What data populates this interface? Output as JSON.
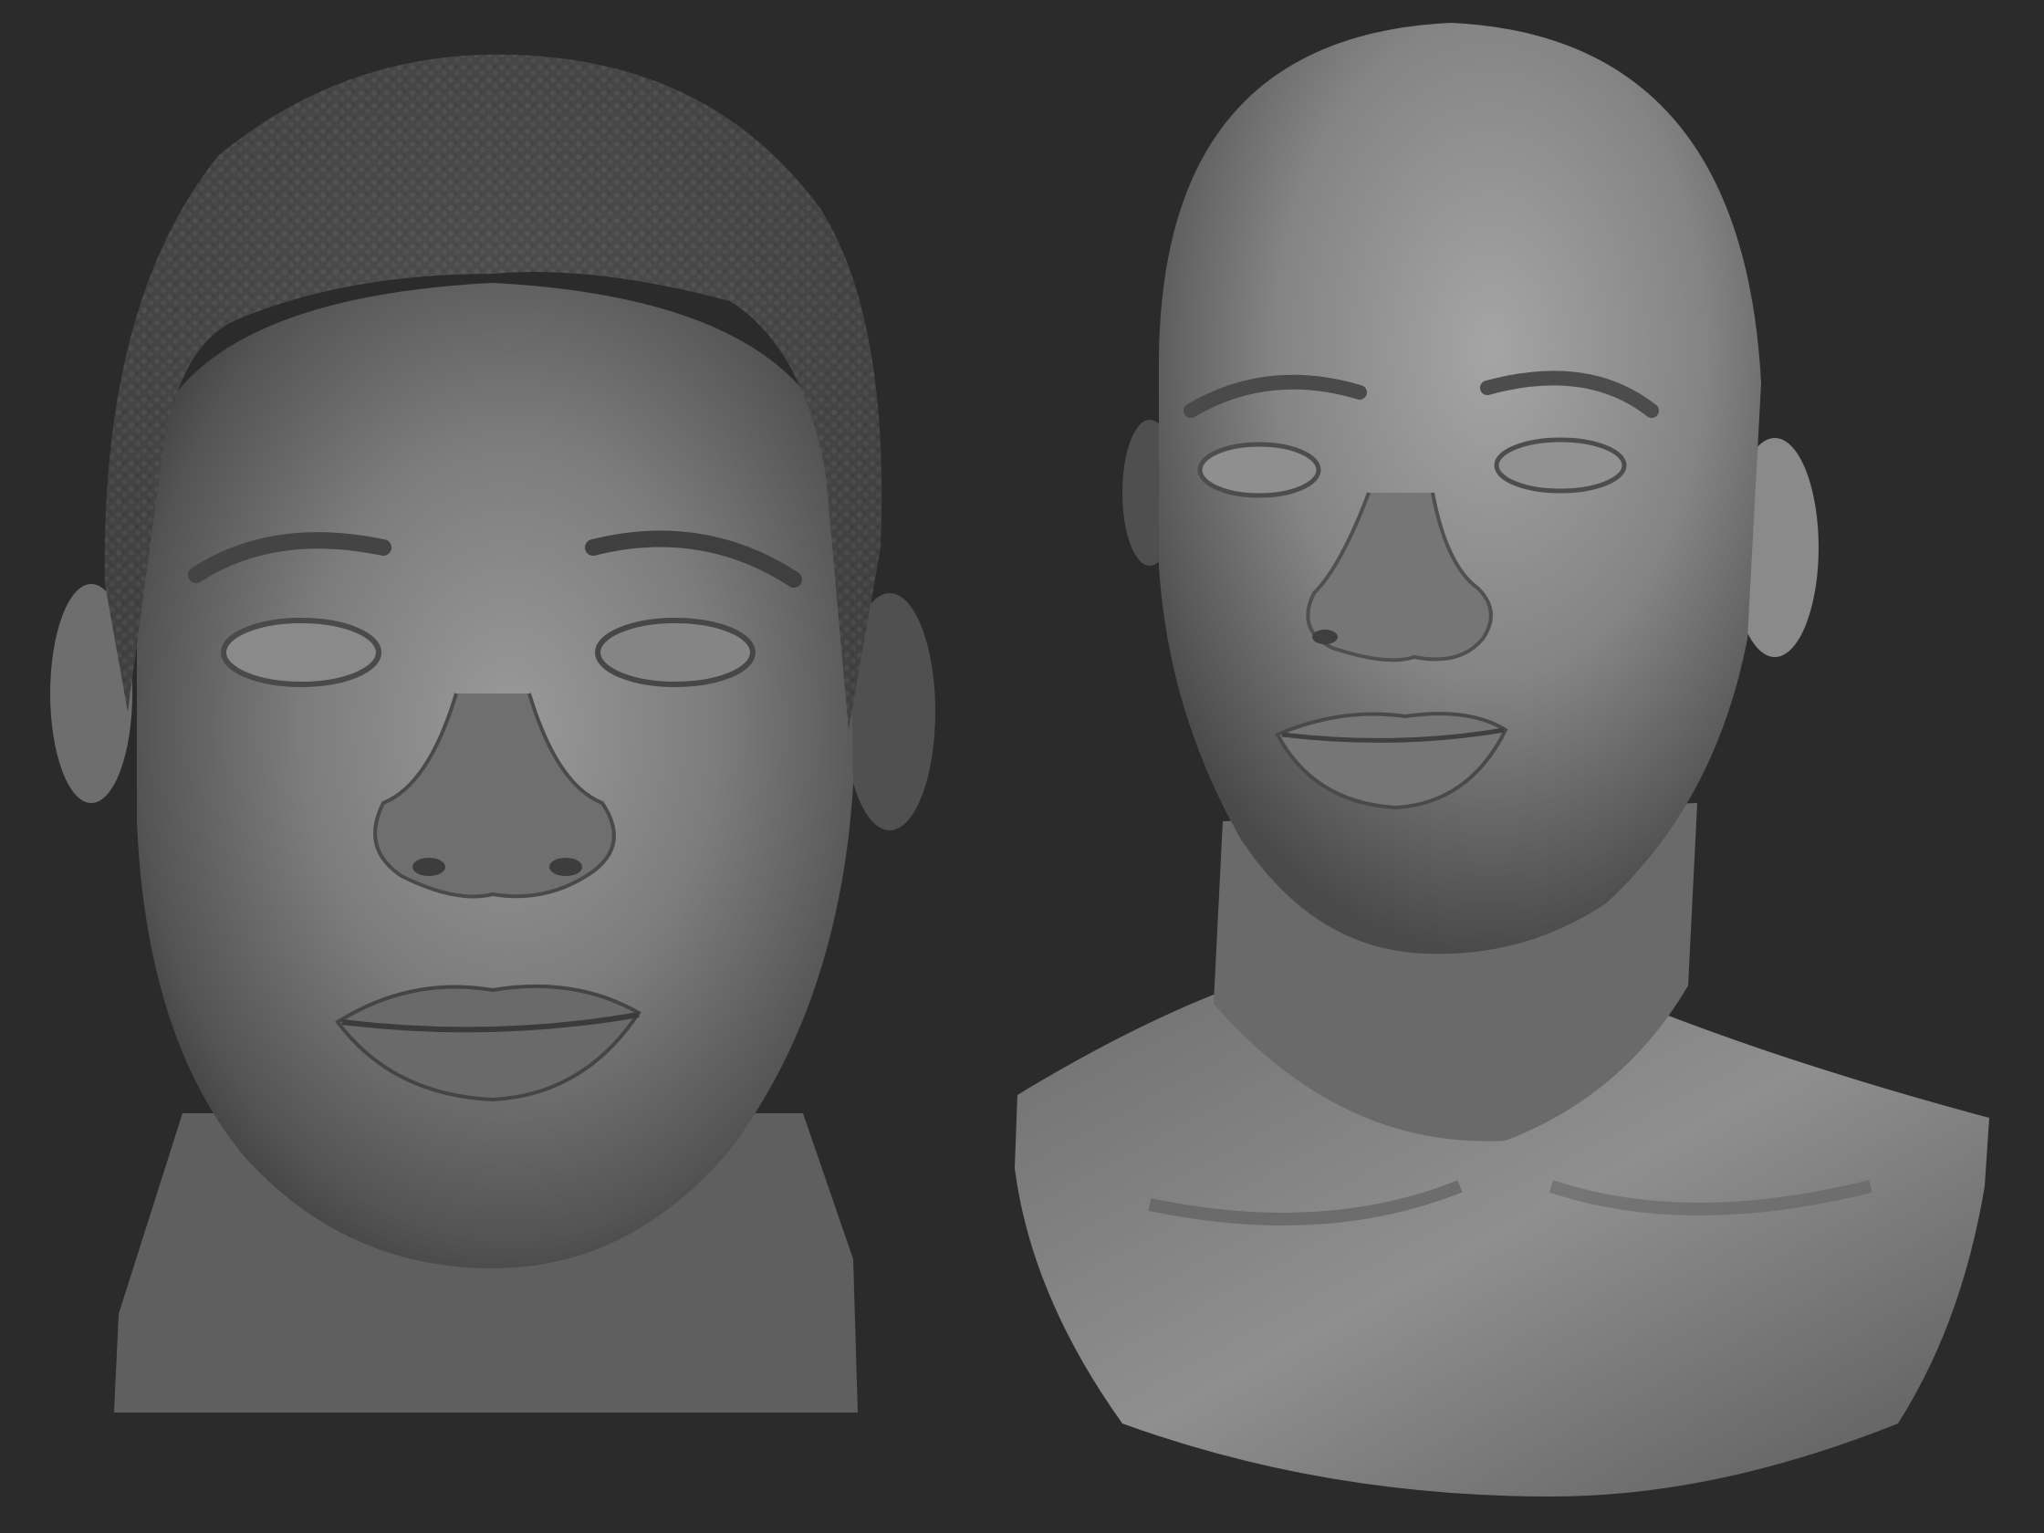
{
  "scene": {
    "background_color": "#2b2b2b",
    "clay_color": "#7a7a7a",
    "clay_highlight": "#a9a9a9",
    "clay_shadow": "#3a3a3a",
    "hair_color": "#4a4a4a"
  },
  "sculpts": [
    {
      "name": "front-view-head-with-hair"
    },
    {
      "name": "three-quarter-view-bald-bust"
    }
  ]
}
